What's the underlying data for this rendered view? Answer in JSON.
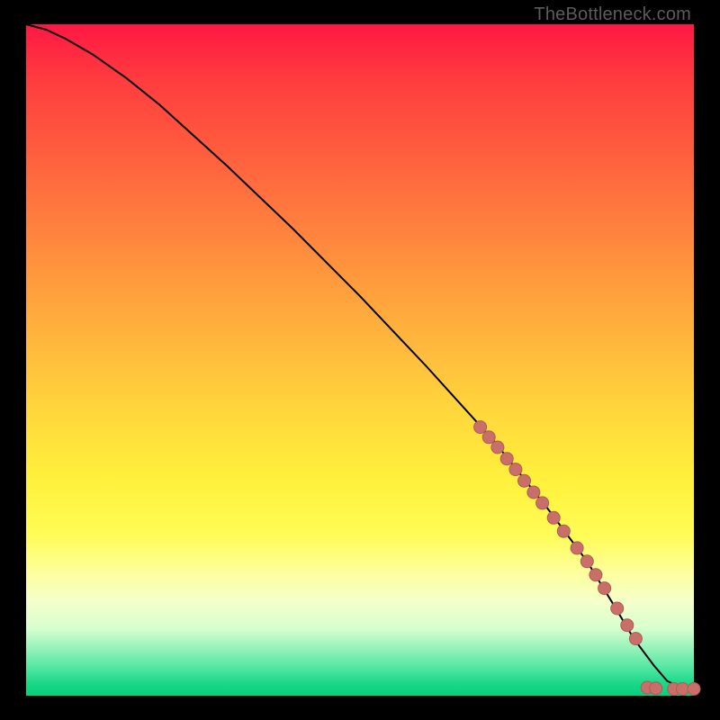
{
  "watermark": "TheBottleneck.com",
  "colors": {
    "curve": "#000000",
    "marker_fill": "#c96f6a",
    "marker_stroke": "#b15a55"
  },
  "chart_data": {
    "type": "line",
    "title": "",
    "xlabel": "",
    "ylabel": "",
    "xlim": [
      0,
      100
    ],
    "ylim": [
      0,
      100
    ],
    "curve": {
      "x": [
        0,
        3,
        6,
        10,
        15,
        20,
        30,
        40,
        50,
        60,
        70,
        78,
        84,
        88,
        91,
        94,
        96,
        98,
        100
      ],
      "y": [
        100,
        99.2,
        97.8,
        95.5,
        92.0,
        88.0,
        79.0,
        69.5,
        59.5,
        49.0,
        38.0,
        28.0,
        20.0,
        13.5,
        8.5,
        4.5,
        2.2,
        1.2,
        1.0
      ]
    },
    "markers": [
      {
        "x": 68.0,
        "y": 40.0
      },
      {
        "x": 69.3,
        "y": 38.5
      },
      {
        "x": 70.6,
        "y": 37.0
      },
      {
        "x": 72.0,
        "y": 35.3
      },
      {
        "x": 73.3,
        "y": 33.7
      },
      {
        "x": 74.6,
        "y": 32.0
      },
      {
        "x": 76.0,
        "y": 30.3
      },
      {
        "x": 77.3,
        "y": 28.7
      },
      {
        "x": 79.0,
        "y": 26.5
      },
      {
        "x": 80.5,
        "y": 24.5
      },
      {
        "x": 82.5,
        "y": 22.0
      },
      {
        "x": 84.0,
        "y": 20.0
      },
      {
        "x": 85.3,
        "y": 18.0
      },
      {
        "x": 86.6,
        "y": 16.0
      },
      {
        "x": 88.5,
        "y": 13.0
      },
      {
        "x": 90.0,
        "y": 10.5
      },
      {
        "x": 91.3,
        "y": 8.5
      },
      {
        "x": 93.0,
        "y": 1.2
      },
      {
        "x": 94.3,
        "y": 1.1
      },
      {
        "x": 97.0,
        "y": 1.0
      },
      {
        "x": 98.3,
        "y": 1.0
      },
      {
        "x": 100.0,
        "y": 1.0
      }
    ]
  }
}
